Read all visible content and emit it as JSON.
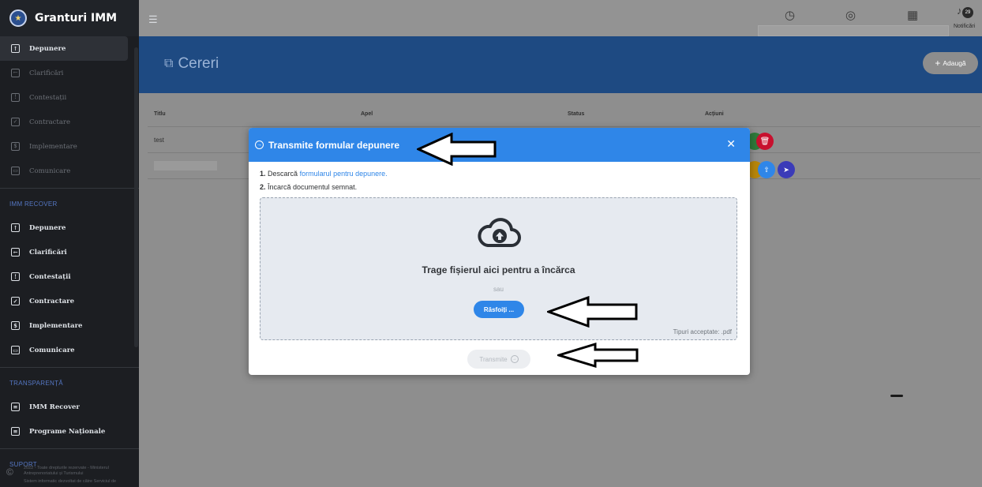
{
  "app": {
    "brand": "Granturi IMM"
  },
  "sidebar": {
    "top_items": [
      {
        "label": "Depunere",
        "icon": "upload-box-icon"
      },
      {
        "label": "Clarificări",
        "icon": "arrow-box-icon"
      },
      {
        "label": "Contestații",
        "icon": "exclamation-box-icon"
      },
      {
        "label": "Contractare",
        "icon": "check-box-icon"
      },
      {
        "label": "Implementare",
        "icon": "dollar-box-icon"
      },
      {
        "label": "Comunicare",
        "icon": "chat-icon"
      }
    ],
    "section_recover": "IMM RECOVER",
    "recover_items": [
      {
        "label": "Depunere"
      },
      {
        "label": "Clarificări"
      },
      {
        "label": "Contestații"
      },
      {
        "label": "Contractare"
      },
      {
        "label": "Implementare"
      },
      {
        "label": "Comunicare"
      }
    ],
    "section_transparency": "TRANSPARENȚĂ",
    "transparency_items": [
      {
        "label": "IMM Recover"
      },
      {
        "label": "Programe Naționale"
      }
    ],
    "section_support": "SUPORT",
    "footer_copyright": "2022 - Toate drepturile rezervate - Ministerul Antreprenoriatului și Turismului",
    "footer_system": "Sistem informatic dezvoltat de către Serviciul de"
  },
  "topbar": {
    "notification_count": "29",
    "notification_label": "Notificări"
  },
  "page": {
    "title": "Cereri",
    "add_label": "Adaugă"
  },
  "table": {
    "headers": [
      "Titlu",
      "Apel",
      "Status",
      "Acțiuni"
    ],
    "rows": [
      {
        "title": "test"
      }
    ]
  },
  "modal": {
    "title": "Transmite formular depunere",
    "step1_num": "1.",
    "step1_text": "Descarcă",
    "step1_link": "formularul pentru depunere.",
    "step2_num": "2.",
    "step2_text": "Încarcă documentul semnat.",
    "drop_title": "Trage fișierul aici pentru a încărca",
    "drop_or": "sau",
    "browse_label": "Răsfoiți ...",
    "accepted_types": "Tipuri acceptate: .pdf",
    "submit_label": "Transmite"
  },
  "colors": {
    "primary": "#2f86e8",
    "sidebar_bg": "#1c1e22",
    "delete": "#c8102e",
    "send": "#3b3bb8"
  }
}
